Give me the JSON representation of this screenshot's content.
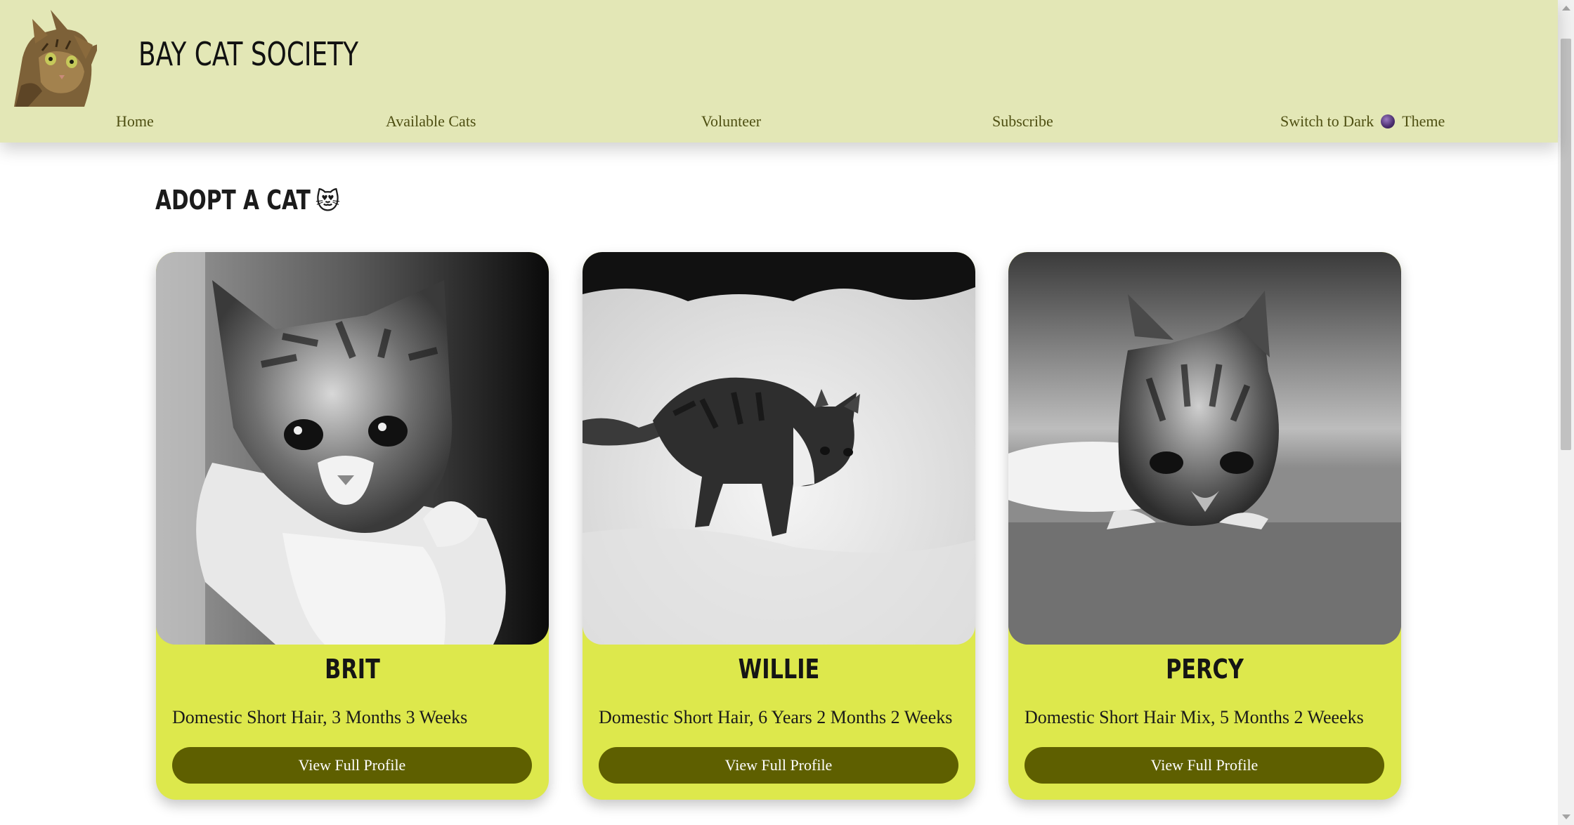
{
  "site": {
    "title": "BAY CAT SOCIETY",
    "logo_icon": "cat-logo"
  },
  "nav": {
    "items": [
      {
        "label": "Home"
      },
      {
        "label": "Available Cats"
      },
      {
        "label": "Volunteer"
      },
      {
        "label": "Subscribe"
      }
    ],
    "theme_switch": {
      "label_before": "Switch to Dark",
      "icon": "planet-icon",
      "label_after": "Theme"
    }
  },
  "main": {
    "heading": "ADOPT A CAT",
    "heading_emoji": "😻"
  },
  "cats": [
    {
      "name": "BRIT",
      "description": "Domestic Short Hair, 3 Months 3 Weeks",
      "button": "View Full Profile"
    },
    {
      "name": "WILLIE",
      "description": "Domestic Short Hair, 6 Years 2 Months 2 Weeks",
      "button": "View Full Profile"
    },
    {
      "name": "PERCY",
      "description": "Domestic Short Hair Mix, 5 Months 2 Weeeks",
      "button": "View Full Profile"
    }
  ],
  "colors": {
    "header_bg": "#e3e7b6",
    "card_bg": "#dde84c",
    "button_bg": "#5e5f00",
    "nav_text": "#4e4f12"
  }
}
